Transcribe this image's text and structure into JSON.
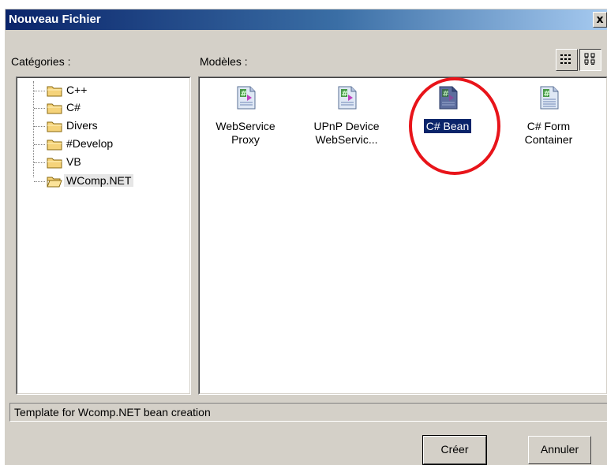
{
  "window": {
    "title": "Nouveau Fichier",
    "close_label": "x"
  },
  "categories": {
    "label": "Catégories :",
    "items": [
      {
        "label": "C++",
        "selected": false
      },
      {
        "label": "C#",
        "selected": false
      },
      {
        "label": "Divers",
        "selected": false
      },
      {
        "label": "#Develop",
        "selected": false
      },
      {
        "label": "VB",
        "selected": false
      },
      {
        "label": "WComp.NET",
        "selected": true
      }
    ]
  },
  "templates": {
    "label": "Modèles :",
    "items": [
      {
        "label_line1": "WebService",
        "label_line2": "Proxy",
        "icon": "code-file-icon",
        "selected": false
      },
      {
        "label_line1": "UPnP Device",
        "label_line2": "WebServic...",
        "icon": "code-file-icon",
        "selected": false
      },
      {
        "label_line1": "C# Bean",
        "label_line2": "",
        "icon": "code-file-icon",
        "selected": true
      },
      {
        "label_line1": "C# Form",
        "label_line2": "Container",
        "icon": "form-file-icon",
        "selected": false
      }
    ],
    "view_modes": [
      "list-view-icon",
      "large-icons-view-icon"
    ]
  },
  "description": "Template for Wcomp.NET bean creation",
  "buttons": {
    "create": "Créer",
    "cancel": "Annuler"
  },
  "colors": {
    "title_start": "#0a246a",
    "title_end": "#a6caf0",
    "selection": "#0a246a",
    "highlight_circle": "#e8141a",
    "folder": "#f5d37a"
  }
}
